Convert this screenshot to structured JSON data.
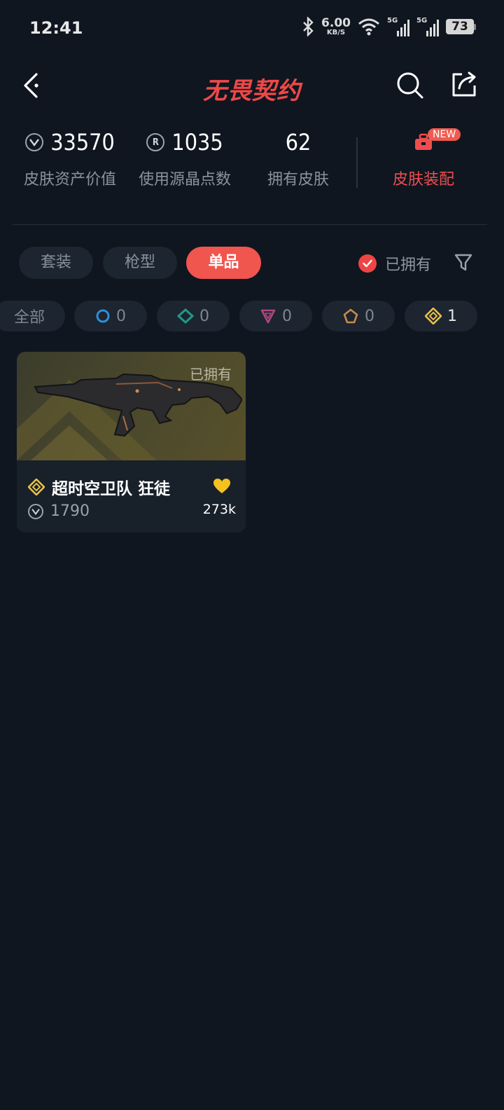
{
  "status": {
    "time": "12:41",
    "speed_value": "6.00",
    "speed_unit": "KB/S",
    "net1": "5G",
    "net2": "5G",
    "battery": "73"
  },
  "header": {
    "title": "无畏契约"
  },
  "stats": [
    {
      "value": "33570",
      "label": "皮肤资产价值",
      "icon": "vp-coin-icon"
    },
    {
      "value": "1035",
      "label": "使用源晶点数",
      "icon": "radianite-icon"
    },
    {
      "value": "62",
      "label": "拥有皮肤"
    }
  ],
  "equip": {
    "badge": "NEW",
    "label": "皮肤装配"
  },
  "tabs": [
    {
      "label": "套装",
      "active": false
    },
    {
      "label": "枪型",
      "active": false
    },
    {
      "label": "单品",
      "active": true
    }
  ],
  "owned_filter": {
    "label": "已拥有",
    "checked": true
  },
  "rarity_filters": [
    {
      "label": "全部"
    },
    {
      "icon": "select-tier-icon",
      "color": "#2f8fd8",
      "count": "0"
    },
    {
      "icon": "deluxe-tier-icon",
      "color": "#1f9a8a",
      "count": "0"
    },
    {
      "icon": "premium-tier-icon",
      "color": "#b0477f",
      "count": "0"
    },
    {
      "icon": "ultra-tier-icon",
      "color": "#c98a4a",
      "count": "0"
    },
    {
      "icon": "exclusive-tier-icon",
      "color": "#e8c04a",
      "count": "1"
    }
  ],
  "items": [
    {
      "name": "超时空卫队 狂徒",
      "owned_label": "已拥有",
      "price": "1790",
      "likes": "273k",
      "tier_color": "#e8c04a"
    }
  ]
}
